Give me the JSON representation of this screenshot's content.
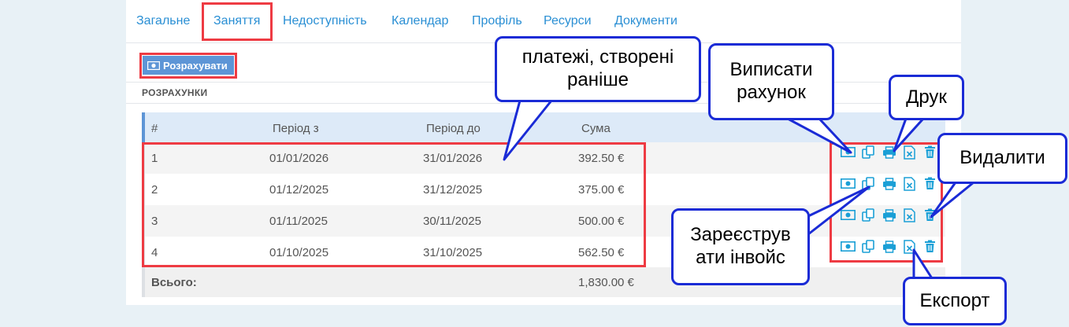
{
  "tabs": [
    "Загальне",
    "Заняття",
    "Недоступність",
    "Календар",
    "Профіль",
    "Ресурси",
    "Документи"
  ],
  "active_tab": "Заняття",
  "toolbar": {
    "calculate_label": "Розрахувати",
    "calculate_icon": "money-icon"
  },
  "section_title": "РОЗРАХУНКИ",
  "table": {
    "headers": [
      "#",
      "Період з",
      "Період до",
      "Сума"
    ],
    "rows": [
      {
        "num": "1",
        "from": "01/01/2026",
        "to": "31/01/2026",
        "sum": "392.50 €"
      },
      {
        "num": "2",
        "from": "01/12/2025",
        "to": "31/12/2025",
        "sum": "375.00 €"
      },
      {
        "num": "3",
        "from": "01/11/2025",
        "to": "30/11/2025",
        "sum": "500.00 €"
      },
      {
        "num": "4",
        "from": "01/10/2025",
        "to": "31/10/2025",
        "sum": "562.50 €"
      }
    ],
    "total_label": "Всього:",
    "total_value": "1,830.00 €",
    "row_actions": [
      "money-icon",
      "copy-icon",
      "print-icon",
      "excel-icon",
      "trash-icon"
    ]
  },
  "annotations": {
    "payments": "платежі, створені раніше",
    "invoice": "Виписати рахунок",
    "print": "Друк",
    "delete": "Видалити",
    "register": "Зареєструв ати інвойс",
    "export": "Експорт"
  },
  "colors": {
    "accent": "#2a8fd4",
    "button": "#5d95d6",
    "highlight": "#ee3b43",
    "callout": "#1a2bd6"
  }
}
